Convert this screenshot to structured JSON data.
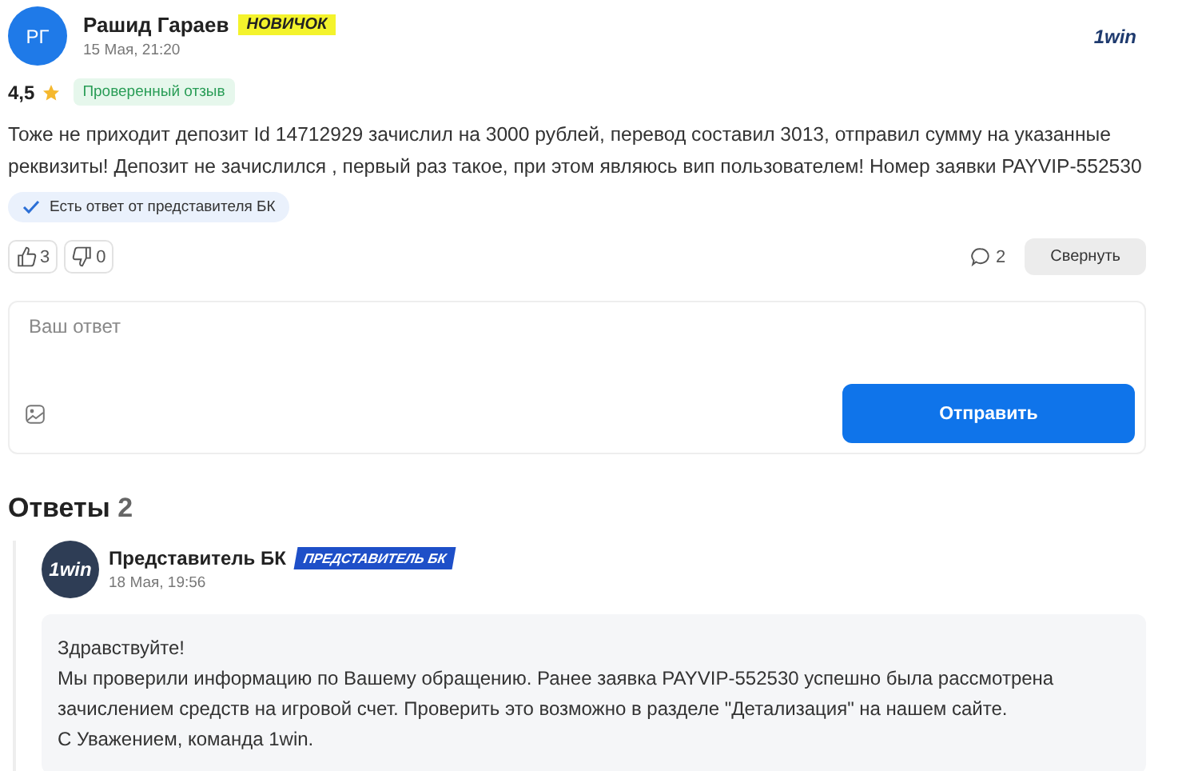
{
  "review": {
    "avatar_initials": "РГ",
    "author": "Рашид Гараев",
    "badge": "НОВИЧОК",
    "date": "15 Мая, 21:20",
    "brand_logo": "1win",
    "rating": "4,5",
    "verified": "Проверенный отзыв",
    "text": "Тоже не приходит депозит Id 14712929 зачислил на 3000 рублей, перевод составил 3013, отправил сумму на указанные реквизиты! Депозит не зачислился , первый раз такое, при этом являюсь вип пользователем! Номер заявки PAYVIP-552530",
    "answer_note": "Есть ответ от представителя БК",
    "likes": "3",
    "dislikes": "0",
    "comments": "2",
    "collapse_button": "Свернуть"
  },
  "reply_form": {
    "placeholder": "Ваш ответ",
    "submit_button": "Отправить"
  },
  "answers": {
    "title": "Ответы",
    "count": "2",
    "items": [
      {
        "avatar_logo": "1win",
        "author": "Представитель БК",
        "badge": "ПРЕДСТАВИТЕЛЬ БК",
        "date": "18 Мая, 19:56",
        "lines": [
          "Здравствуйте!",
          "Мы проверили информацию по Вашему обращению. Ранее заявка PAYVIP-552530 успешно была рассмотрена",
          "зачислением средств на игровой счет. Проверить это возможно в разделе \"Детализация\" на нашем сайте.",
          "С Уважением, команда 1win."
        ]
      }
    ]
  }
}
